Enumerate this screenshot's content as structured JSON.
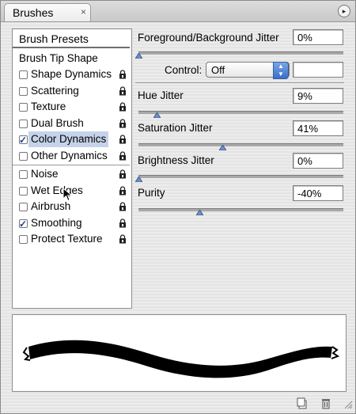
{
  "panel": {
    "tab_label": "Brushes",
    "close_glyph": "×",
    "menu_glyph": "▸"
  },
  "sidebar": {
    "presets_label": "Brush Presets",
    "items": [
      {
        "label": "Brush Tip Shape",
        "checkbox": false,
        "checked": false,
        "lock": false
      },
      {
        "label": "Shape Dynamics",
        "checkbox": true,
        "checked": false,
        "lock": true
      },
      {
        "label": "Scattering",
        "checkbox": true,
        "checked": false,
        "lock": true
      },
      {
        "label": "Texture",
        "checkbox": true,
        "checked": false,
        "lock": true
      },
      {
        "label": "Dual Brush",
        "checkbox": true,
        "checked": false,
        "lock": true
      },
      {
        "label": "Color Dynamics",
        "checkbox": true,
        "checked": true,
        "lock": true,
        "selected": true
      },
      {
        "label": "Other Dynamics",
        "checkbox": true,
        "checked": false,
        "lock": true
      },
      {
        "label": "Noise",
        "checkbox": true,
        "checked": false,
        "lock": true
      },
      {
        "label": "Wet Edges",
        "checkbox": true,
        "checked": false,
        "lock": true
      },
      {
        "label": "Airbrush",
        "checkbox": true,
        "checked": false,
        "lock": true
      },
      {
        "label": "Smoothing",
        "checkbox": true,
        "checked": true,
        "lock": true
      },
      {
        "label": "Protect Texture",
        "checkbox": true,
        "checked": false,
        "lock": true
      }
    ]
  },
  "settings": {
    "fg_bg_jitter": {
      "label": "Foreground/Background Jitter",
      "value": "0%",
      "slider_level": 0.0
    },
    "control": {
      "label": "Control:",
      "selected": "Off",
      "extra_value": ""
    },
    "hue_jitter": {
      "label": "Hue Jitter",
      "value": "9%",
      "slider_level": 0.09
    },
    "saturation_jitter": {
      "label": "Saturation Jitter",
      "value": "41%",
      "slider_level": 0.41
    },
    "brightness_jitter": {
      "label": "Brightness Jitter",
      "value": "0%",
      "slider_level": 0.0
    },
    "purity": {
      "label": "Purity",
      "value": "-40%",
      "slider_level": 0.3
    }
  },
  "icons": {
    "lock": "lock-icon",
    "new_brush": "new-brush-icon",
    "trash": "trash-icon",
    "cursor": "arrow-cursor-icon"
  },
  "colors": {
    "selection": "#c5d3ea",
    "select_arrow": "#3b6fc6",
    "stroke": "#000000"
  }
}
